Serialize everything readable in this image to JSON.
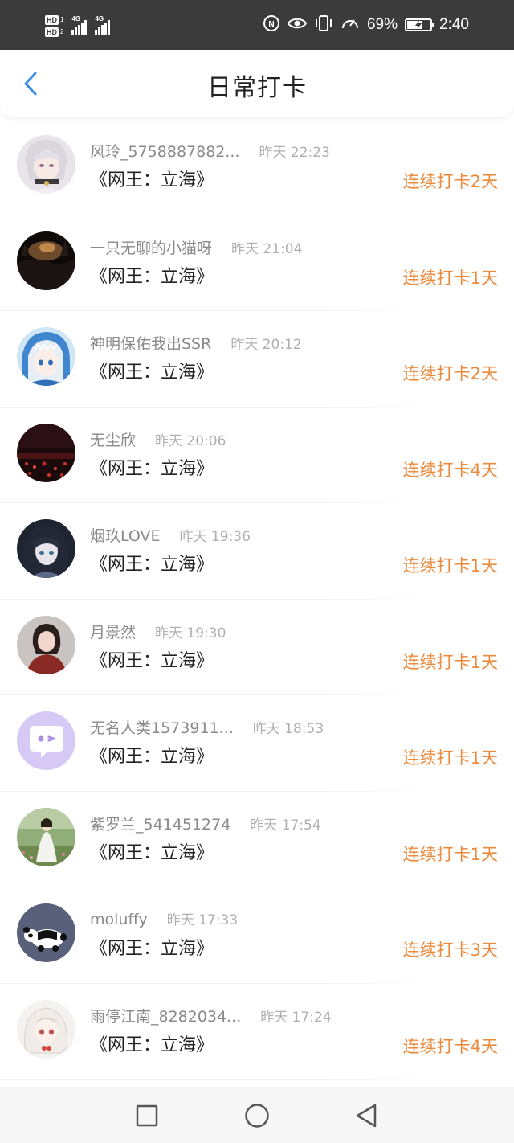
{
  "status_bar": {
    "hd1": "HD",
    "hd1_num": "1",
    "hd2": "HD",
    "hd2_num": "2",
    "net1": "4G",
    "net2": "4G",
    "battery_percent": "69%",
    "battery_level": 0.69,
    "time": "2:40",
    "icons": [
      "nfc-icon",
      "eye-icon",
      "vibrate-icon",
      "speedometer-icon",
      "battery-charging-icon"
    ]
  },
  "header": {
    "title": "日常打卡",
    "back_icon": "back-arrow-icon"
  },
  "colors": {
    "accent": "#ec8a3c",
    "back_arrow": "#3a8ee6",
    "status_bar_bg": "#3b3b3b"
  },
  "checkins": [
    {
      "user": "风玲_5758887882...",
      "time": "昨天 22:23",
      "book": "《网王：立海》",
      "streak": "连续打卡2天",
      "avatar": "anime-girl-avatar"
    },
    {
      "user": "一只无聊的小猫呀",
      "time": "昨天 21:04",
      "book": "《网王：立海》",
      "streak": "连续打卡1天",
      "avatar": "sunset-avatar"
    },
    {
      "user": "神明保佑我出SSR",
      "time": "昨天 20:12",
      "book": "《网王：立海》",
      "streak": "连续打卡2天",
      "avatar": "shark-girl-avatar"
    },
    {
      "user": "无尘欣",
      "time": "昨天 20:06",
      "book": "《网王：立海》",
      "streak": "连续打卡4天",
      "avatar": "red-night-avatar"
    },
    {
      "user": "烟玖LOVE",
      "time": "昨天 19:36",
      "book": "《网王：立海》",
      "streak": "连续打卡1天",
      "avatar": "dark-anime-avatar"
    },
    {
      "user": "月景然",
      "time": "昨天 19:30",
      "book": "《网王：立海》",
      "streak": "连续打卡1天",
      "avatar": "girl-photo-avatar"
    },
    {
      "user": "无名人类1573911...",
      "time": "昨天 18:53",
      "book": "《网王：立海》",
      "streak": "连续打卡1天",
      "avatar": "chat-bubble-avatar"
    },
    {
      "user": "紫罗兰_541451274",
      "time": "昨天 17:54",
      "book": "《网王：立海》",
      "streak": "连续打卡1天",
      "avatar": "flower-field-avatar"
    },
    {
      "user": "moluffy",
      "time": "昨天 17:33",
      "book": "《网王：立海》",
      "streak": "连续打卡3天",
      "avatar": "panda-avatar"
    },
    {
      "user": "雨停江南_8282034...",
      "time": "昨天 17:24",
      "book": "《网王：立海》",
      "streak": "连续打卡4天",
      "avatar": "white-hair-girl-avatar"
    }
  ],
  "nav_bar": {
    "buttons": [
      "recents-square-icon",
      "home-circle-icon",
      "back-triangle-icon"
    ]
  }
}
